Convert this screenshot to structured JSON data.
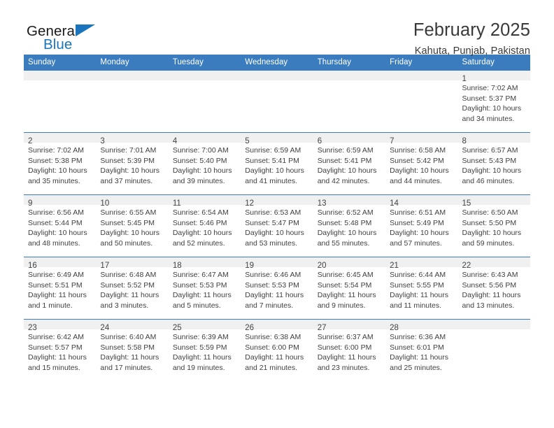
{
  "brand": {
    "name_part1": "General",
    "name_part2": "Blue",
    "accent_color": "#1b75bc"
  },
  "header": {
    "title": "February 2025",
    "subtitle": "Kahuta, Punjab, Pakistan"
  },
  "theme": {
    "header_row_bg": "#3a7cbe",
    "daynum_bg": "#f0f0f0",
    "text_color": "#3f3f3f"
  },
  "weekday_headers": [
    "Sunday",
    "Monday",
    "Tuesday",
    "Wednesday",
    "Thursday",
    "Friday",
    "Saturday"
  ],
  "weeks": [
    [
      {
        "day": "",
        "sunrise": "",
        "sunset": "",
        "daylight": "",
        "blank": true
      },
      {
        "day": "",
        "sunrise": "",
        "sunset": "",
        "daylight": "",
        "blank": true
      },
      {
        "day": "",
        "sunrise": "",
        "sunset": "",
        "daylight": "",
        "blank": true
      },
      {
        "day": "",
        "sunrise": "",
        "sunset": "",
        "daylight": "",
        "blank": true
      },
      {
        "day": "",
        "sunrise": "",
        "sunset": "",
        "daylight": "",
        "blank": true
      },
      {
        "day": "",
        "sunrise": "",
        "sunset": "",
        "daylight": "",
        "blank": true
      },
      {
        "day": "1",
        "sunrise": "Sunrise: 7:02 AM",
        "sunset": "Sunset: 5:37 PM",
        "daylight": "Daylight: 10 hours and 34 minutes."
      }
    ],
    [
      {
        "day": "2",
        "sunrise": "Sunrise: 7:02 AM",
        "sunset": "Sunset: 5:38 PM",
        "daylight": "Daylight: 10 hours and 35 minutes."
      },
      {
        "day": "3",
        "sunrise": "Sunrise: 7:01 AM",
        "sunset": "Sunset: 5:39 PM",
        "daylight": "Daylight: 10 hours and 37 minutes."
      },
      {
        "day": "4",
        "sunrise": "Sunrise: 7:00 AM",
        "sunset": "Sunset: 5:40 PM",
        "daylight": "Daylight: 10 hours and 39 minutes."
      },
      {
        "day": "5",
        "sunrise": "Sunrise: 6:59 AM",
        "sunset": "Sunset: 5:41 PM",
        "daylight": "Daylight: 10 hours and 41 minutes."
      },
      {
        "day": "6",
        "sunrise": "Sunrise: 6:59 AM",
        "sunset": "Sunset: 5:41 PM",
        "daylight": "Daylight: 10 hours and 42 minutes."
      },
      {
        "day": "7",
        "sunrise": "Sunrise: 6:58 AM",
        "sunset": "Sunset: 5:42 PM",
        "daylight": "Daylight: 10 hours and 44 minutes."
      },
      {
        "day": "8",
        "sunrise": "Sunrise: 6:57 AM",
        "sunset": "Sunset: 5:43 PM",
        "daylight": "Daylight: 10 hours and 46 minutes."
      }
    ],
    [
      {
        "day": "9",
        "sunrise": "Sunrise: 6:56 AM",
        "sunset": "Sunset: 5:44 PM",
        "daylight": "Daylight: 10 hours and 48 minutes."
      },
      {
        "day": "10",
        "sunrise": "Sunrise: 6:55 AM",
        "sunset": "Sunset: 5:45 PM",
        "daylight": "Daylight: 10 hours and 50 minutes."
      },
      {
        "day": "11",
        "sunrise": "Sunrise: 6:54 AM",
        "sunset": "Sunset: 5:46 PM",
        "daylight": "Daylight: 10 hours and 52 minutes."
      },
      {
        "day": "12",
        "sunrise": "Sunrise: 6:53 AM",
        "sunset": "Sunset: 5:47 PM",
        "daylight": "Daylight: 10 hours and 53 minutes."
      },
      {
        "day": "13",
        "sunrise": "Sunrise: 6:52 AM",
        "sunset": "Sunset: 5:48 PM",
        "daylight": "Daylight: 10 hours and 55 minutes."
      },
      {
        "day": "14",
        "sunrise": "Sunrise: 6:51 AM",
        "sunset": "Sunset: 5:49 PM",
        "daylight": "Daylight: 10 hours and 57 minutes."
      },
      {
        "day": "15",
        "sunrise": "Sunrise: 6:50 AM",
        "sunset": "Sunset: 5:50 PM",
        "daylight": "Daylight: 10 hours and 59 minutes."
      }
    ],
    [
      {
        "day": "16",
        "sunrise": "Sunrise: 6:49 AM",
        "sunset": "Sunset: 5:51 PM",
        "daylight": "Daylight: 11 hours and 1 minute."
      },
      {
        "day": "17",
        "sunrise": "Sunrise: 6:48 AM",
        "sunset": "Sunset: 5:52 PM",
        "daylight": "Daylight: 11 hours and 3 minutes."
      },
      {
        "day": "18",
        "sunrise": "Sunrise: 6:47 AM",
        "sunset": "Sunset: 5:53 PM",
        "daylight": "Daylight: 11 hours and 5 minutes."
      },
      {
        "day": "19",
        "sunrise": "Sunrise: 6:46 AM",
        "sunset": "Sunset: 5:53 PM",
        "daylight": "Daylight: 11 hours and 7 minutes."
      },
      {
        "day": "20",
        "sunrise": "Sunrise: 6:45 AM",
        "sunset": "Sunset: 5:54 PM",
        "daylight": "Daylight: 11 hours and 9 minutes."
      },
      {
        "day": "21",
        "sunrise": "Sunrise: 6:44 AM",
        "sunset": "Sunset: 5:55 PM",
        "daylight": "Daylight: 11 hours and 11 minutes."
      },
      {
        "day": "22",
        "sunrise": "Sunrise: 6:43 AM",
        "sunset": "Sunset: 5:56 PM",
        "daylight": "Daylight: 11 hours and 13 minutes."
      }
    ],
    [
      {
        "day": "23",
        "sunrise": "Sunrise: 6:42 AM",
        "sunset": "Sunset: 5:57 PM",
        "daylight": "Daylight: 11 hours and 15 minutes."
      },
      {
        "day": "24",
        "sunrise": "Sunrise: 6:40 AM",
        "sunset": "Sunset: 5:58 PM",
        "daylight": "Daylight: 11 hours and 17 minutes."
      },
      {
        "day": "25",
        "sunrise": "Sunrise: 6:39 AM",
        "sunset": "Sunset: 5:59 PM",
        "daylight": "Daylight: 11 hours and 19 minutes."
      },
      {
        "day": "26",
        "sunrise": "Sunrise: 6:38 AM",
        "sunset": "Sunset: 6:00 PM",
        "daylight": "Daylight: 11 hours and 21 minutes."
      },
      {
        "day": "27",
        "sunrise": "Sunrise: 6:37 AM",
        "sunset": "Sunset: 6:00 PM",
        "daylight": "Daylight: 11 hours and 23 minutes."
      },
      {
        "day": "28",
        "sunrise": "Sunrise: 6:36 AM",
        "sunset": "Sunset: 6:01 PM",
        "daylight": "Daylight: 11 hours and 25 minutes."
      },
      {
        "day": "",
        "sunrise": "",
        "sunset": "",
        "daylight": "",
        "blank": true
      }
    ]
  ]
}
